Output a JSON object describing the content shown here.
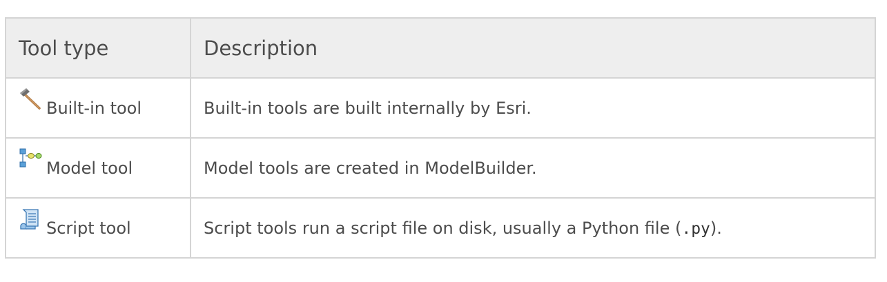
{
  "table": {
    "headers": {
      "tool_type": "Tool type",
      "description": "Description"
    },
    "rows": [
      {
        "icon": "hammer-icon",
        "tool_type": "Built-in tool",
        "description": "Built-in tools are built internally by Esri."
      },
      {
        "icon": "model-icon",
        "tool_type": "Model tool",
        "description": "Model tools are created in ModelBuilder."
      },
      {
        "icon": "script-icon",
        "tool_type": "Script tool",
        "description_before": "Script tools run a script file on disk, usually a Python file (",
        "description_code": ".py",
        "description_after": ")."
      }
    ]
  }
}
